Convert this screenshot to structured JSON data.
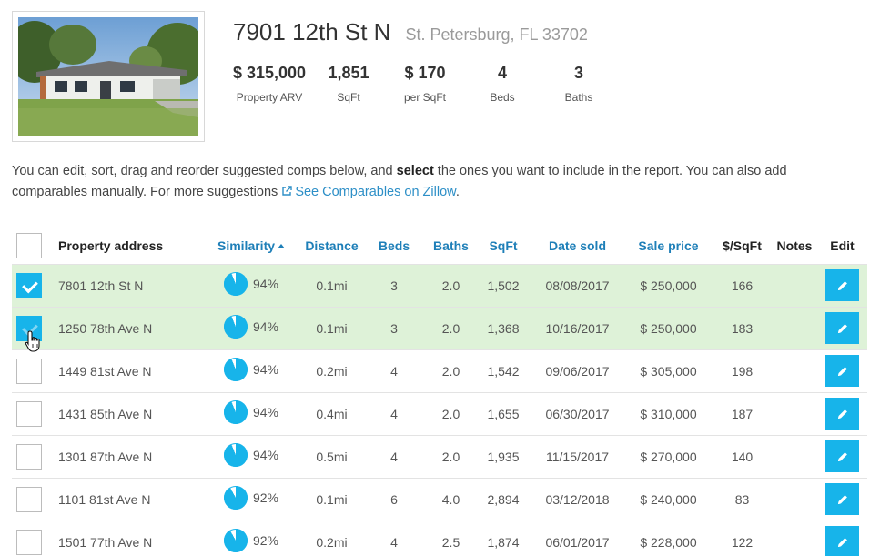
{
  "property": {
    "street": "7901 12th St N",
    "city": "St. Petersburg, FL 33702",
    "stats": [
      {
        "value": "$ 315,000",
        "label": "Property ARV"
      },
      {
        "value": "1,851",
        "label": "SqFt"
      },
      {
        "value": "$ 170",
        "label": "per SqFt"
      },
      {
        "value": "4",
        "label": "Beds"
      },
      {
        "value": "3",
        "label": "Baths"
      }
    ]
  },
  "intro": {
    "before": "You can edit, sort, drag and reorder suggested comps below, and ",
    "bold": "select",
    "after": " the ones you want to include in the report. You can also add comparables manually. For more suggestions ",
    "link": "See Comparables on Zillow",
    "end": "."
  },
  "table": {
    "headers": {
      "address": "Property address",
      "similarity": "Similarity",
      "distance": "Distance",
      "beds": "Beds",
      "baths": "Baths",
      "sqft": "SqFt",
      "date": "Date sold",
      "price": "Sale price",
      "ppsf": "$/SqFt",
      "notes": "Notes",
      "edit": "Edit"
    },
    "rows": [
      {
        "address": "7801 12th St N",
        "similarity": "94%",
        "sim_value": 0.94,
        "distance": "0.1mi",
        "beds": "3",
        "baths": "2.0",
        "sqft": "1,502",
        "date": "08/08/2017",
        "price": "$ 250,000",
        "ppsf": "166",
        "selected": true
      },
      {
        "address": "1250 78th Ave N",
        "similarity": "94%",
        "sim_value": 0.94,
        "distance": "0.1mi",
        "beds": "3",
        "baths": "2.0",
        "sqft": "1,368",
        "date": "10/16/2017",
        "price": "$ 250,000",
        "ppsf": "183",
        "selected": true
      },
      {
        "address": "1449 81st Ave N",
        "similarity": "94%",
        "sim_value": 0.94,
        "distance": "0.2mi",
        "beds": "4",
        "baths": "2.0",
        "sqft": "1,542",
        "date": "09/06/2017",
        "price": "$ 305,000",
        "ppsf": "198",
        "selected": false
      },
      {
        "address": "1431 85th Ave N",
        "similarity": "94%",
        "sim_value": 0.94,
        "distance": "0.4mi",
        "beds": "4",
        "baths": "2.0",
        "sqft": "1,655",
        "date": "06/30/2017",
        "price": "$ 310,000",
        "ppsf": "187",
        "selected": false
      },
      {
        "address": "1301 87th Ave N",
        "similarity": "94%",
        "sim_value": 0.94,
        "distance": "0.5mi",
        "beds": "4",
        "baths": "2.0",
        "sqft": "1,935",
        "date": "11/15/2017",
        "price": "$ 270,000",
        "ppsf": "140",
        "selected": false
      },
      {
        "address": "1101 81st Ave N",
        "similarity": "92%",
        "sim_value": 0.92,
        "distance": "0.1mi",
        "beds": "6",
        "baths": "4.0",
        "sqft": "2,894",
        "date": "03/12/2018",
        "price": "$ 240,000",
        "ppsf": "83",
        "selected": false
      },
      {
        "address": "1501 77th Ave N",
        "similarity": "92%",
        "sim_value": 0.92,
        "distance": "0.2mi",
        "beds": "4",
        "baths": "2.5",
        "sqft": "1,874",
        "date": "06/01/2017",
        "price": "$ 228,000",
        "ppsf": "122",
        "selected": false
      }
    ]
  },
  "colors": {
    "accent": "#17b4ea",
    "link": "#1e7fb8",
    "selected_row": "#def2d8"
  },
  "icons": {
    "edit": "pencil-icon",
    "external_link": "external-link-icon",
    "sort": "sort-ascending-icon"
  }
}
